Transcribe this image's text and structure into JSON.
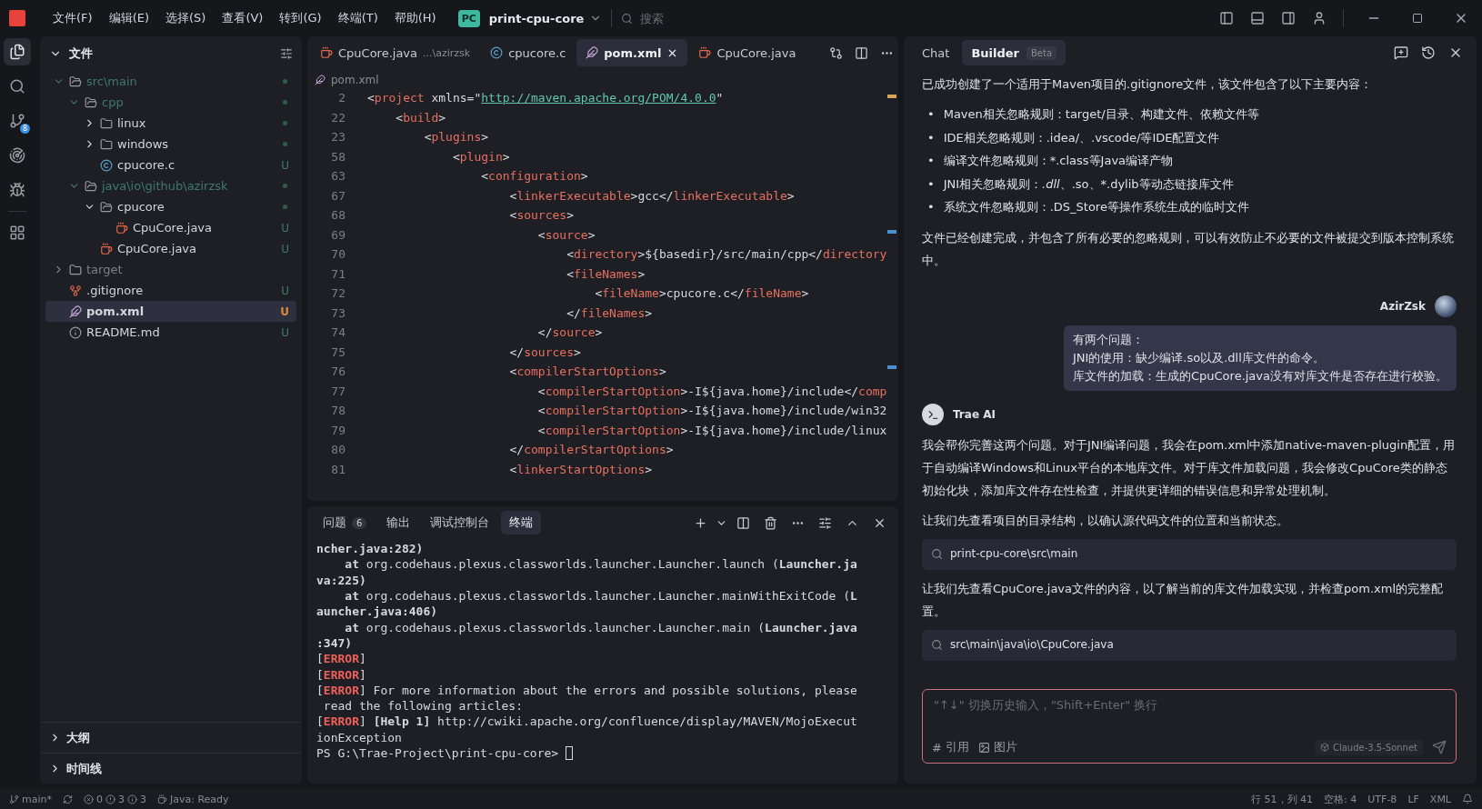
{
  "title_bar": {
    "menus": [
      "文件(F)",
      "编辑(E)",
      "选择(S)",
      "查看(V)",
      "转到(G)",
      "终端(T)",
      "帮助(H)"
    ],
    "project_badge": "PC",
    "project": "print-cpu-core",
    "search": {
      "placeholder": "搜索"
    }
  },
  "activity_bar": [
    {
      "kind": "files",
      "selected": true
    },
    {
      "kind": "search",
      "selected": false
    },
    {
      "kind": "git",
      "selected": false,
      "badge": "8"
    },
    {
      "kind": "remote",
      "selected": false
    },
    {
      "kind": "debug",
      "selected": false
    },
    {
      "kind": "extensions",
      "selected": false
    }
  ],
  "sidebar": {
    "title": "文件",
    "tree": [
      {
        "label": "src\\main",
        "kind": "folder",
        "expanded": true,
        "dimmed": true,
        "changed": true,
        "selected": false,
        "children": [
          {
            "label": "cpp",
            "kind": "folder",
            "expanded": true,
            "dimmed": true,
            "changed": true,
            "selected": false,
            "children": [
              {
                "label": "linux",
                "kind": "folder",
                "expanded": false,
                "dimmed": false,
                "changed": true,
                "selected": false
              },
              {
                "label": "windows",
                "kind": "folder",
                "expanded": false,
                "dimmed": false,
                "changed": true,
                "selected": false
              },
              {
                "label": "cpucore.c",
                "kind": "c",
                "dimmed": false,
                "status": "U",
                "selected": false
              }
            ]
          },
          {
            "label": "java\\io\\github\\azirzsk",
            "kind": "folder",
            "expanded": true,
            "dimmed": true,
            "changed": true,
            "selected": false,
            "children": [
              {
                "label": "cpucore",
                "kind": "folder",
                "expanded": true,
                "dimmed": false,
                "changed": true,
                "selected": false,
                "children": [
                  {
                    "label": "CpuCore.java",
                    "kind": "java",
                    "dimmed": false,
                    "status": "U",
                    "selected": false
                  }
                ]
              },
              {
                "label": "CpuCore.java",
                "kind": "java",
                "dimmed": false,
                "status": "U",
                "selected": false
              }
            ]
          }
        ]
      },
      {
        "label": "target",
        "kind": "folder",
        "expanded": false,
        "dimmed": true,
        "changed": false,
        "selected": false
      },
      {
        "label": ".gitignore",
        "kind": "git",
        "dimmed": false,
        "status": "U",
        "selected": false
      },
      {
        "label": "pom.xml",
        "kind": "xml",
        "dimmed": false,
        "status": "U",
        "selected": true
      },
      {
        "label": "README.md",
        "kind": "info",
        "dimmed": false,
        "status": "U",
        "selected": false
      }
    ],
    "sections": [
      {
        "label": "大纲",
        "expanded": false
      },
      {
        "label": "时间线",
        "expanded": false
      }
    ]
  },
  "editor": {
    "tabs": [
      {
        "label": "CpuCore.java",
        "detail": "...\\azirzsk",
        "kind": "java",
        "selected": false
      },
      {
        "label": "cpucore.c",
        "kind": "c",
        "selected": false
      },
      {
        "label": "pom.xml",
        "kind": "xml",
        "selected": true
      },
      {
        "label": "CpuCore.java",
        "kind": "java",
        "selected": false
      }
    ],
    "breadcrumb": "pom.xml",
    "lines": [
      {
        "number": "2",
        "text": "<project xmlns=\"http://maven.apache.org/POM/4.0.0\""
      },
      {
        "number": "22",
        "text": "    <build>"
      },
      {
        "number": "23",
        "text": "        <plugins>"
      },
      {
        "number": "58",
        "text": "            <plugin>"
      },
      {
        "number": "63",
        "text": "                <configuration>"
      },
      {
        "number": "67",
        "text": "                    <linkerExecutable>gcc</linkerExecutable>"
      },
      {
        "number": "68",
        "text": "                    <sources>"
      },
      {
        "number": "69",
        "text": "                        <source>"
      },
      {
        "number": "70",
        "text": "                            <directory>${basedir}/src/main/cpp</directory"
      },
      {
        "number": "71",
        "text": "                            <fileNames>"
      },
      {
        "number": "72",
        "text": "                                <fileName>cpucore.c</fileName>"
      },
      {
        "number": "73",
        "text": "                            </fileNames>"
      },
      {
        "number": "74",
        "text": "                        </source>"
      },
      {
        "number": "75",
        "text": "                    </sources>"
      },
      {
        "number": "76",
        "text": "                    <compilerStartOptions>"
      },
      {
        "number": "77",
        "text": "                        <compilerStartOption>-I${java.home}/include</comp"
      },
      {
        "number": "78",
        "text": "                        <compilerStartOption>-I${java.home}/include/win32"
      },
      {
        "number": "79",
        "text": "                        <compilerStartOption>-I${java.home}/include/linux"
      },
      {
        "number": "80",
        "text": "                    </compilerStartOptions>"
      },
      {
        "number": "81",
        "text": "                    <linkerStartOptions>"
      }
    ]
  },
  "panel": {
    "tabs": [
      {
        "label": "问题",
        "count": "6",
        "selected": false
      },
      {
        "label": "输出",
        "selected": false
      },
      {
        "label": "调试控制台",
        "selected": false
      },
      {
        "label": "终端",
        "selected": true
      }
    ],
    "terminal": [
      [
        {
          "kind": "bold",
          "text": "ncher.java:282)"
        }
      ],
      [
        {
          "kind": "bold",
          "text": "    at "
        },
        {
          "kind": "plain",
          "text": "org.codehaus.plexus.classworlds.launcher.Launcher.launch ("
        },
        {
          "kind": "bold",
          "text": "Launcher.ja"
        }
      ],
      [
        {
          "kind": "bold",
          "text": "va:225)"
        }
      ],
      [
        {
          "kind": "bold",
          "text": "    at "
        },
        {
          "kind": "plain",
          "text": "org.codehaus.plexus.classworlds.launcher.Launcher.mainWithExitCode ("
        },
        {
          "kind": "bold",
          "text": "L"
        }
      ],
      [
        {
          "kind": "bold",
          "text": "auncher.java:406)"
        }
      ],
      [
        {
          "kind": "bold",
          "text": "    at "
        },
        {
          "kind": "plain",
          "text": "org.codehaus.plexus.classworlds.launcher.Launcher.main ("
        },
        {
          "kind": "bold",
          "text": "Launcher.java"
        }
      ],
      [
        {
          "kind": "bold",
          "text": ":347)"
        }
      ],
      [
        {
          "kind": "plain",
          "text": "["
        },
        {
          "kind": "error",
          "text": "ERROR"
        },
        {
          "kind": "plain",
          "text": "]"
        }
      ],
      [
        {
          "kind": "plain",
          "text": "["
        },
        {
          "kind": "error",
          "text": "ERROR"
        },
        {
          "kind": "plain",
          "text": "]"
        }
      ],
      [
        {
          "kind": "plain",
          "text": "["
        },
        {
          "kind": "error",
          "text": "ERROR"
        },
        {
          "kind": "plain",
          "text": "] For more information about the errors and possible solutions, please"
        }
      ],
      [
        {
          "kind": "plain",
          "text": " read the following articles:"
        }
      ],
      [
        {
          "kind": "plain",
          "text": "["
        },
        {
          "kind": "error",
          "text": "ERROR"
        },
        {
          "kind": "plain",
          "text": "] "
        },
        {
          "kind": "bold",
          "text": "[Help 1]"
        },
        {
          "kind": "plain",
          "text": " http://cwiki.apache.org/confluence/display/MAVEN/MojoExecut"
        }
      ],
      [
        {
          "kind": "plain",
          "text": "ionException"
        }
      ],
      [
        {
          "kind": "prompt",
          "text": "PS G:\\Trae-Project\\print-cpu-core> "
        }
      ]
    ]
  },
  "chat": {
    "tabs": [
      {
        "label": "Chat",
        "selected": false
      },
      {
        "label": "Builder",
        "badge": "Beta",
        "selected": true
      }
    ],
    "messages": [
      {
        "kind": "ai",
        "blocks": [
          {
            "kind": "text",
            "text": "已成功创建了一个适用于Maven项目的.gitignore文件，该文件包含了以下主要内容："
          },
          {
            "kind": "bullets",
            "marker": "•",
            "items": [
              [
                {
                  "text": "Maven相关忽略规则：target/目录、构建文件、依赖文件等",
                  "italic": false
                }
              ],
              [
                {
                  "text": "IDE相关忽略规则：.idea/、.vscode/等IDE配置文件",
                  "italic": false
                }
              ],
              [
                {
                  "text": "编译文件忽略规则：*.class等Java编译产物",
                  "italic": false
                }
              ],
              [
                {
                  "text": "JNI相关忽略规则：",
                  "italic": false
                },
                {
                  "text": ".dll",
                  "italic": true
                },
                {
                  "text": "、.so、*.dylib等动态链接库文件",
                  "italic": false
                }
              ],
              [
                {
                  "text": "系统文件忽略规则：.DS_Store等操作系统生成的临时文件",
                  "italic": false
                }
              ]
            ]
          },
          {
            "kind": "text",
            "text": "文件已经创建完成，并包含了所有必要的忽略规则，可以有效防止不必要的文件被提交到版本控制系统中。"
          }
        ]
      },
      {
        "kind": "user",
        "author": "AzirZsk",
        "lines": [
          "有两个问题：",
          "JNI的使用：缺少编译.so以及.dll库文件的命令。",
          "库文件的加载：生成的CpuCore.java没有对库文件是否存在进行校验。"
        ]
      },
      {
        "kind": "ai",
        "author": "Trae AI",
        "blocks": [
          {
            "kind": "text",
            "text": "我会帮你完善这两个问题。对于JNI编译问题，我会在pom.xml中添加native-maven-plugin配置，用于自动编译Windows和Linux平台的本地库文件。对于库文件加载问题，我会修改CpuCore类的静态初始化块，添加库文件存在性检查，并提供更详细的错误信息和异常处理机制。"
          },
          {
            "kind": "text",
            "text": "让我们先查看项目的目录结构，以确认源代码文件的位置和当前状态。"
          },
          {
            "kind": "tool",
            "text": "print-cpu-core\\src\\main"
          },
          {
            "kind": "text",
            "text": "让我们先查看CpuCore.java文件的内容，以了解当前的库文件加载实现，并检查pom.xml的完整配置。"
          },
          {
            "kind": "tool",
            "text": "src\\main\\java\\io\\CpuCore.java"
          }
        ]
      }
    ],
    "input": {
      "placeholder": "\"↑↓\" 切换历史输入，\"Shift+Enter\" 换行",
      "reference_icon": "#",
      "reference": "引用",
      "image": "图片",
      "model": "Claude-3.5-Sonnet"
    }
  },
  "status_bar": {
    "branch": "main*",
    "errors": "0",
    "warnings": "3",
    "infos": "3",
    "java": "Java: Ready",
    "position": "行 51，列 41",
    "spaces": "空格: 4",
    "encoding": "UTF-8",
    "eol": "LF",
    "language": "XML"
  }
}
